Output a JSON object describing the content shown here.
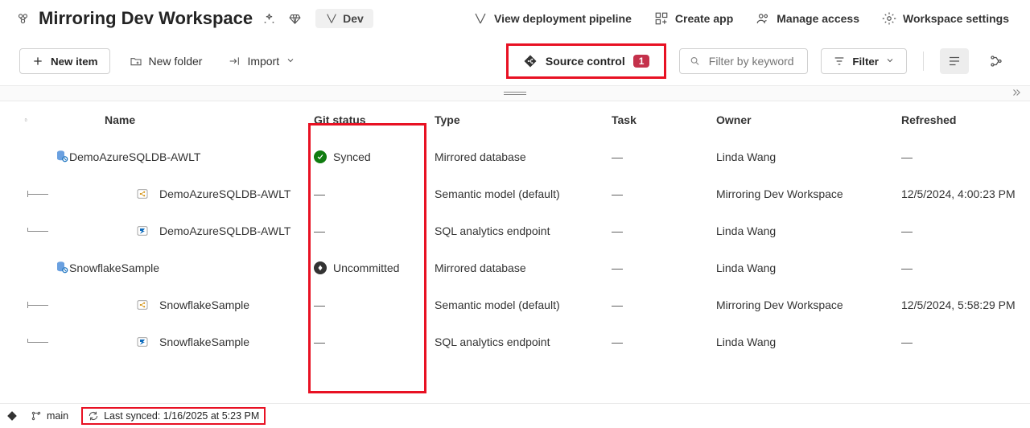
{
  "header": {
    "title": "Mirroring Dev Workspace",
    "dev_pill": "Dev",
    "links": {
      "pipeline": "View deployment pipeline",
      "create_app": "Create app",
      "manage_access": "Manage access",
      "settings": "Workspace settings"
    }
  },
  "toolbar": {
    "new_item": "New item",
    "new_folder": "New folder",
    "import": "Import",
    "source_control": "Source control",
    "source_badge": "1",
    "filter_placeholder": "Filter by keyword",
    "filter_btn": "Filter"
  },
  "columns": {
    "name": "Name",
    "git": "Git status",
    "type": "Type",
    "task": "Task",
    "owner": "Owner",
    "refreshed": "Refreshed"
  },
  "git_labels": {
    "synced": "Synced",
    "uncommitted": "Uncommitted"
  },
  "rows": [
    {
      "name": "DemoAzureSQLDB-AWLT",
      "type": "Mirrored database",
      "task": "—",
      "owner": "Linda Wang",
      "refreshed": "—"
    },
    {
      "name": "DemoAzureSQLDB-AWLT",
      "type": "Semantic model (default)",
      "task": "—",
      "owner": "Mirroring Dev Workspace",
      "refreshed": "12/5/2024, 4:00:23 PM"
    },
    {
      "name": "DemoAzureSQLDB-AWLT",
      "type": "SQL analytics endpoint",
      "task": "—",
      "owner": "Linda Wang",
      "refreshed": "—"
    },
    {
      "name": "SnowflakeSample",
      "type": "Mirrored database",
      "task": "—",
      "owner": "Linda Wang",
      "refreshed": "—"
    },
    {
      "name": "SnowflakeSample",
      "type": "Semantic model (default)",
      "task": "—",
      "owner": "Mirroring Dev Workspace",
      "refreshed": "12/5/2024, 5:58:29 PM"
    },
    {
      "name": "SnowflakeSample",
      "type": "SQL analytics endpoint",
      "task": "—",
      "owner": "Linda Wang",
      "refreshed": "—"
    }
  ],
  "footer": {
    "branch": "main",
    "last_synced": "Last synced: 1/16/2025 at 5:23 PM"
  }
}
